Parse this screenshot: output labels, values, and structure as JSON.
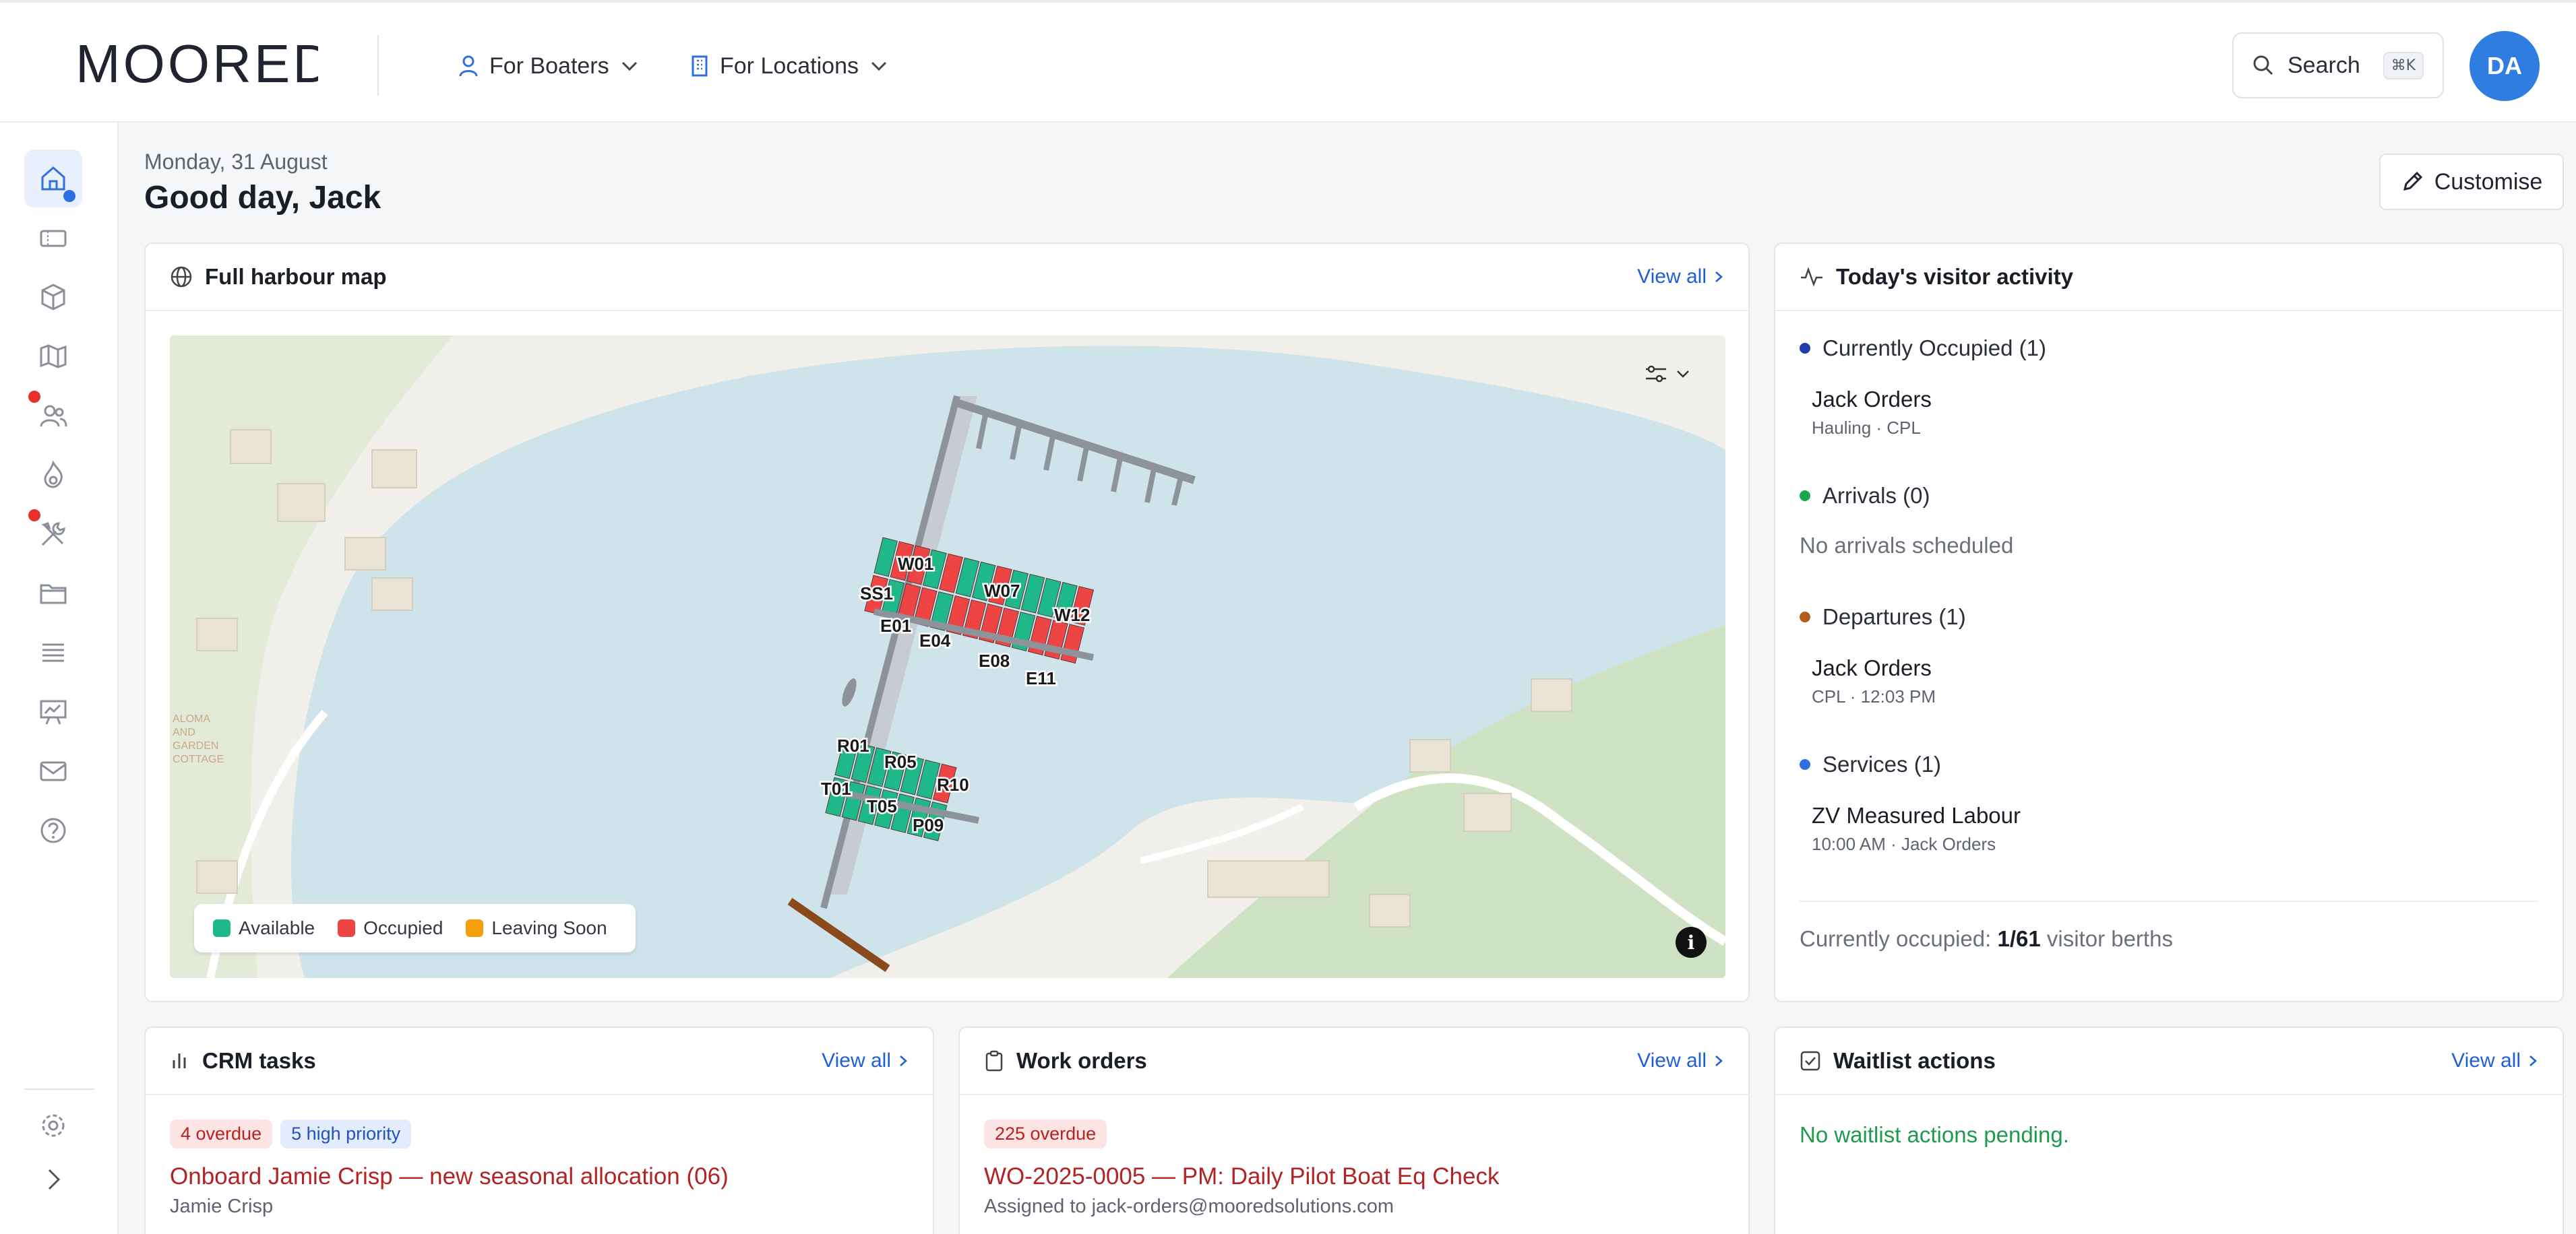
{
  "header": {
    "logo": "MOORED",
    "nav": [
      {
        "label": "For Boaters"
      },
      {
        "label": "For Locations"
      }
    ],
    "search": {
      "label": "Search",
      "shortcut": "⌘K"
    },
    "avatar": "DA"
  },
  "rail": {
    "items": [
      {
        "icon": "home-icon",
        "active": true
      },
      {
        "icon": "ticket-icon"
      },
      {
        "icon": "box-icon"
      },
      {
        "icon": "map-icon"
      },
      {
        "icon": "users-icon",
        "alert": true
      },
      {
        "icon": "flame-icon"
      },
      {
        "icon": "tools-icon",
        "alert": true
      },
      {
        "icon": "folder-icon"
      },
      {
        "icon": "list-icon"
      },
      {
        "icon": "presentation-chart-icon"
      },
      {
        "icon": "mail-icon"
      },
      {
        "icon": "help-icon"
      }
    ],
    "footer": [
      {
        "icon": "settings-icon"
      },
      {
        "icon": "expand-icon"
      }
    ]
  },
  "greeting": {
    "date": "Monday, 31 August",
    "title": "Good day, Jack",
    "customise_label": "Customise"
  },
  "map_card": {
    "title": "Full harbour map",
    "view_all": "View all",
    "berth_labels": [
      "W01",
      "SS1",
      "W07",
      "W12",
      "E01",
      "E04",
      "E08",
      "E11",
      "R01",
      "R05",
      "R10",
      "T01",
      "T05",
      "P09"
    ],
    "shore_text": [
      "ALOMA",
      "AND",
      "GARDEN",
      "COTTAGE"
    ],
    "legend": [
      {
        "label": "Available",
        "color": "#1fb888"
      },
      {
        "label": "Occupied",
        "color": "#ef4444"
      },
      {
        "label": "Leaving Soon",
        "color": "#f59e0b"
      }
    ],
    "info": "i"
  },
  "visitor_card": {
    "title": "Today's visitor activity",
    "sections": [
      {
        "label": "Currently Occupied (1)",
        "color": "#1f3fa8",
        "entries": [
          {
            "name": "Jack Orders",
            "sub": "Hauling · CPL"
          }
        ]
      },
      {
        "label": "Arrivals (0)",
        "color": "#1aa64f",
        "empty": "No arrivals scheduled"
      },
      {
        "label": "Departures (1)",
        "color": "#b35a1f",
        "entries": [
          {
            "name": "Jack Orders",
            "sub": "CPL · 12:03 PM"
          }
        ]
      },
      {
        "label": "Services (1)",
        "color": "#2f6fe0",
        "entries": [
          {
            "name": "ZV Measured Labour",
            "sub": "10:00 AM · Jack Orders"
          }
        ]
      }
    ],
    "footer_prefix": "Currently occupied: ",
    "footer_value": "1/61",
    "footer_suffix": " visitor berths"
  },
  "crm_card": {
    "title": "CRM tasks",
    "view_all": "View all",
    "badges": [
      "4 overdue",
      "5 high priority"
    ],
    "task_title": "Onboard Jamie Crisp — new seasonal allocation (06)",
    "task_sub": "Jamie Crisp"
  },
  "work_card": {
    "title": "Work orders",
    "view_all": "View all",
    "badge": "225 overdue",
    "task_title": "WO-2025-0005 — PM: Daily Pilot Boat Eq Check",
    "task_sub": "Assigned to jack-orders@mooredsolutions.com"
  },
  "waitlist_card": {
    "title": "Waitlist actions",
    "view_all": "View all",
    "message": "No waitlist actions pending."
  }
}
